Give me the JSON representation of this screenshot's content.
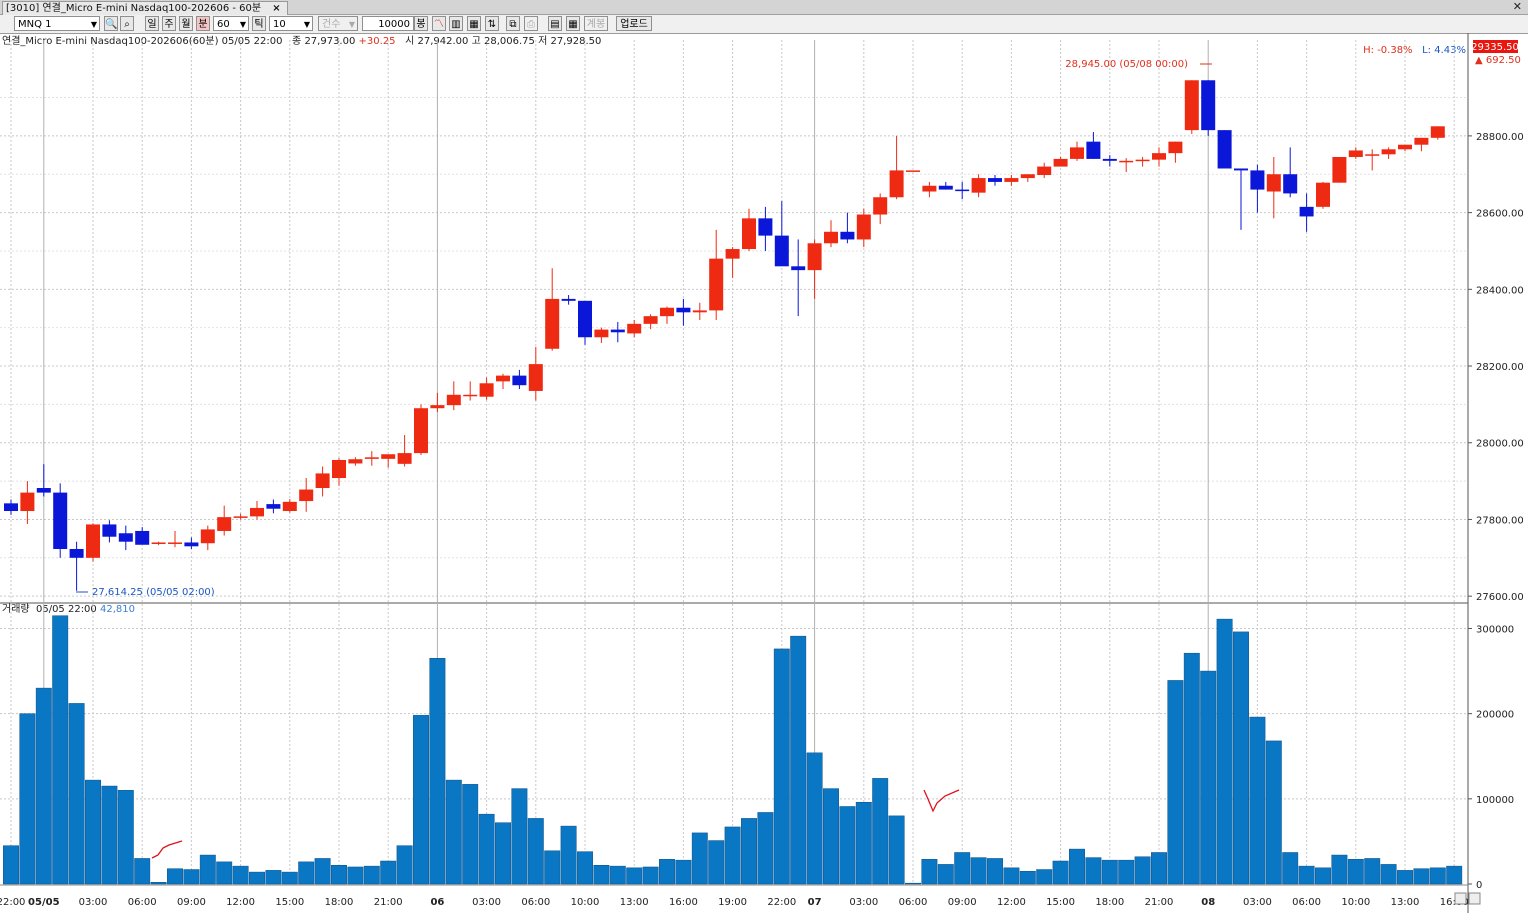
{
  "window": {
    "tab_title": "[3010] 연결_Micro E-mini Nasdaq100-202606 - 60분",
    "tab_close": "×",
    "close_glyph": "✕"
  },
  "toolbar": {
    "symbol": "MNQ 1",
    "period_buttons": [
      "일",
      "주",
      "월",
      "분"
    ],
    "active_period": "분",
    "interval": "60",
    "tick_label": "틱",
    "tick_value": "10",
    "count_label": "건수",
    "count_value": "10000",
    "bar_unit": "봉",
    "upload_label": "업로드",
    "disabled_label": "계봉"
  },
  "info": {
    "title": "연결_Micro E-mini Nasdaq100-202606(60분)",
    "datetime": "05/05 22:00",
    "close_label": "종",
    "close": "27,973.00",
    "change": "+30.25",
    "open_label": "시",
    "open": "27,942.00",
    "high_label": "고",
    "high": "28,006.75",
    "low_label": "저",
    "low": "27,928.50"
  },
  "volume_info": {
    "label": "거래량",
    "datetime": "05/05 22:00",
    "value": "42,810"
  },
  "hl": {
    "high": "H: -0.38%",
    "low": "L: 4.43%",
    "current_price": "29335.50",
    "change": "▲ 692.50"
  },
  "annotations": {
    "high": "28,945.00 (05/08 00:00)",
    "low": "27,614.25 (05/05 02:00)"
  },
  "colors": {
    "up": "#ee2a12",
    "down": "#0a16d8",
    "volume": "#0a77c4",
    "grid": "#c8c8c8",
    "marker": "#e0101e"
  },
  "chart_data": {
    "type": "candlestick",
    "price_axis": {
      "ticks": [
        27600,
        27800,
        28000,
        28200,
        28400,
        28600,
        28800
      ],
      "tick_labels": [
        "27600.00",
        "27800.00",
        "28000.00",
        "28200.00",
        "28400.00",
        "28600.00",
        "28800.00"
      ],
      "ylim": [
        27590,
        29050
      ]
    },
    "volume_axis": {
      "ticks": [
        0,
        100000,
        200000,
        300000
      ],
      "tick_labels": [
        "0",
        "100000",
        "200000",
        "300000"
      ],
      "ylim": [
        0,
        317000
      ]
    },
    "time_labels": [
      {
        "i": 0,
        "label": "22:00",
        "bold": false
      },
      {
        "i": 2,
        "label": "05/05",
        "bold": true
      },
      {
        "i": 5,
        "label": "03:00",
        "bold": false
      },
      {
        "i": 8,
        "label": "06:00",
        "bold": false
      },
      {
        "i": 11,
        "label": "09:00",
        "bold": false
      },
      {
        "i": 14,
        "label": "12:00",
        "bold": false
      },
      {
        "i": 17,
        "label": "15:00",
        "bold": false
      },
      {
        "i": 20,
        "label": "18:00",
        "bold": false
      },
      {
        "i": 23,
        "label": "21:00",
        "bold": false
      },
      {
        "i": 26,
        "label": "06",
        "bold": true
      },
      {
        "i": 29,
        "label": "03:00",
        "bold": false
      },
      {
        "i": 32,
        "label": "06:00",
        "bold": false
      },
      {
        "i": 35,
        "label": "10:00",
        "bold": false
      },
      {
        "i": 38,
        "label": "13:00",
        "bold": false
      },
      {
        "i": 41,
        "label": "16:00",
        "bold": false
      },
      {
        "i": 44,
        "label": "19:00",
        "bold": false
      },
      {
        "i": 47,
        "label": "22:00",
        "bold": false
      },
      {
        "i": 49,
        "label": "07",
        "bold": true
      },
      {
        "i": 52,
        "label": "03:00",
        "bold": false
      },
      {
        "i": 55,
        "label": "06:00",
        "bold": false
      },
      {
        "i": 58,
        "label": "09:00",
        "bold": false
      },
      {
        "i": 61,
        "label": "12:00",
        "bold": false
      },
      {
        "i": 64,
        "label": "15:00",
        "bold": false
      },
      {
        "i": 67,
        "label": "18:00",
        "bold": false
      },
      {
        "i": 70,
        "label": "21:00",
        "bold": false
      },
      {
        "i": 73,
        "label": "08",
        "bold": true
      },
      {
        "i": 76,
        "label": "03:00",
        "bold": false
      },
      {
        "i": 79,
        "label": "06:00",
        "bold": false
      },
      {
        "i": 82,
        "label": "10:00",
        "bold": false
      },
      {
        "i": 85,
        "label": "13:00",
        "bold": false
      },
      {
        "i": 88,
        "label": "16:00",
        "bold": false
      }
    ],
    "ohlc": [
      [
        27842,
        27852,
        27812,
        27822
      ],
      [
        27822,
        27900,
        27788,
        27870
      ],
      [
        27882,
        27944,
        27860,
        27870
      ],
      [
        27870,
        27894,
        27700,
        27723
      ],
      [
        27723,
        27742,
        27614,
        27700
      ],
      [
        27700,
        27790,
        27690,
        27787
      ],
      [
        27787,
        27798,
        27740,
        27755
      ],
      [
        27764,
        27784,
        27720,
        27742
      ],
      [
        27770,
        27780,
        27736,
        27734
      ],
      [
        27736,
        27742,
        27733,
        27740
      ],
      [
        27738,
        27770,
        27728,
        27740
      ],
      [
        27740,
        27753,
        27723,
        27730
      ],
      [
        27738,
        27784,
        27720,
        27774
      ],
      [
        27770,
        27836,
        27758,
        27806
      ],
      [
        27806,
        27815,
        27800,
        27808
      ],
      [
        27808,
        27848,
        27800,
        27830
      ],
      [
        27840,
        27852,
        27816,
        27828
      ],
      [
        27822,
        27853,
        27818,
        27846
      ],
      [
        27848,
        27908,
        27820,
        27878
      ],
      [
        27882,
        27938,
        27860,
        27920
      ],
      [
        27908,
        27960,
        27888,
        27955
      ],
      [
        27946,
        27962,
        27940,
        27957
      ],
      [
        27958,
        27978,
        27940,
        27962
      ],
      [
        27958,
        27968,
        27935,
        27970
      ],
      [
        27945,
        28020,
        27938,
        27973
      ],
      [
        27973,
        28100,
        27968,
        28090
      ],
      [
        28090,
        28130,
        28080,
        28098
      ],
      [
        28098,
        28160,
        28085,
        28125
      ],
      [
        28122,
        28160,
        28110,
        28125
      ],
      [
        28120,
        28170,
        28112,
        28155
      ],
      [
        28160,
        28180,
        28140,
        28175
      ],
      [
        28175,
        28190,
        28140,
        28150
      ],
      [
        28135,
        28250,
        28110,
        28205
      ],
      [
        28245,
        28455,
        28240,
        28375
      ],
      [
        28375,
        28385,
        28360,
        28370
      ],
      [
        28370,
        28360,
        28255,
        28275
      ],
      [
        28275,
        28300,
        28260,
        28295
      ],
      [
        28295,
        28315,
        28262,
        28288
      ],
      [
        28285,
        28320,
        28275,
        28310
      ],
      [
        28310,
        28335,
        28296,
        28330
      ],
      [
        28330,
        28355,
        28310,
        28352
      ],
      [
        28352,
        28375,
        28305,
        28340
      ],
      [
        28340,
        28365,
        28320,
        28345
      ],
      [
        28345,
        28555,
        28320,
        28480
      ],
      [
        28480,
        28510,
        28430,
        28505
      ],
      [
        28505,
        28610,
        28500,
        28585
      ],
      [
        28585,
        28615,
        28500,
        28540
      ],
      [
        28540,
        28630,
        28495,
        28460
      ],
      [
        28460,
        28530,
        28330,
        28450
      ],
      [
        28450,
        28530,
        28375,
        28520
      ],
      [
        28520,
        28580,
        28510,
        28550
      ],
      [
        28550,
        28600,
        28520,
        28530
      ],
      [
        28530,
        28610,
        28510,
        28595
      ],
      [
        28595,
        28650,
        28570,
        28640
      ],
      [
        28640,
        28800,
        28635,
        28710
      ],
      [
        28710,
        28710,
        28710,
        28710
      ],
      [
        28655,
        28680,
        28640,
        28670
      ],
      [
        28670,
        28680,
        28660,
        28660
      ],
      [
        28660,
        28680,
        28635,
        28656
      ],
      [
        28652,
        28700,
        28640,
        28690
      ],
      [
        28690,
        28698,
        28670,
        28680
      ],
      [
        28680,
        28698,
        28670,
        28690
      ],
      [
        28690,
        28700,
        28680,
        28700
      ],
      [
        28698,
        28730,
        28690,
        28720
      ],
      [
        28720,
        28745,
        28720,
        28740
      ],
      [
        28740,
        28785,
        28735,
        28770
      ],
      [
        28785,
        28810,
        28740,
        28740
      ],
      [
        28740,
        28750,
        28720,
        28735
      ],
      [
        28732,
        28742,
        28706,
        28735
      ],
      [
        28735,
        28745,
        28720,
        28738
      ],
      [
        28738,
        28770,
        28720,
        28755
      ],
      [
        28755,
        28785,
        28730,
        28785
      ],
      [
        28815,
        28945,
        28805,
        28945
      ],
      [
        28945,
        28945,
        28800,
        28815
      ],
      [
        28815,
        28815,
        28725,
        28715
      ],
      [
        28715,
        28715,
        28555,
        28710
      ],
      [
        28710,
        28725,
        28600,
        28660
      ],
      [
        28655,
        28745,
        28585,
        28700
      ],
      [
        28700,
        28770,
        28640,
        28650
      ],
      [
        28615,
        28650,
        28550,
        28590
      ],
      [
        28615,
        28680,
        28610,
        28678
      ],
      [
        28678,
        28745,
        28678,
        28745
      ],
      [
        28745,
        28770,
        28740,
        28762
      ],
      [
        28750,
        28765,
        28710,
        28752
      ],
      [
        28752,
        28770,
        28740,
        28765
      ],
      [
        28765,
        28775,
        28760,
        28777
      ],
      [
        28777,
        28790,
        28760,
        28795
      ],
      [
        28795,
        28825,
        28790,
        28825
      ]
    ],
    "volume": [
      45000,
      200000,
      230000,
      315000,
      212000,
      122000,
      115000,
      110000,
      30000,
      2000,
      18000,
      17000,
      34000,
      26000,
      21000,
      14000,
      16000,
      14000,
      26000,
      30000,
      22000,
      20000,
      21000,
      27000,
      45000,
      198000,
      265000,
      122000,
      117000,
      82000,
      72000,
      112000,
      77000,
      39000,
      68000,
      38000,
      22000,
      21000,
      19000,
      20000,
      29000,
      28000,
      60000,
      51000,
      67000,
      77000,
      84000,
      276000,
      291000,
      154000,
      112000,
      91000,
      96000,
      124000,
      80000,
      1000,
      29000,
      23000,
      37000,
      31000,
      30000,
      19000,
      15000,
      17000,
      27000,
      41000,
      31000,
      28000,
      28000,
      32000,
      37000,
      239000,
      271000,
      250000,
      311000,
      296000,
      196000,
      168000,
      37000,
      21000,
      19000,
      34000,
      29000,
      30000,
      23000,
      16000,
      18000,
      19000,
      21000
    ]
  }
}
